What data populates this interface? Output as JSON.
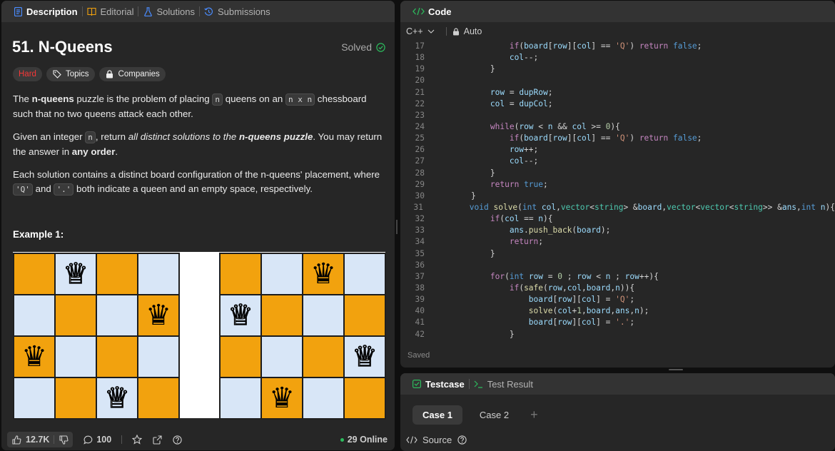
{
  "left_tabs": [
    {
      "label": "Description"
    },
    {
      "label": "Editorial"
    },
    {
      "label": "Solutions"
    },
    {
      "label": "Submissions"
    }
  ],
  "problem": {
    "title": "51. N-Queens",
    "status": "Solved",
    "difficulty": "Hard",
    "tags": [
      "Topics",
      "Companies"
    ],
    "p1": {
      "a": "The ",
      "b": "n-queens",
      "c": " puzzle is the problem of placing ",
      "d": "n",
      "e": " queens on an ",
      "f": "n x n",
      "g": " chessboard such that no two queens attack each other."
    },
    "p2": {
      "a": "Given an integer ",
      "b": "n",
      "c": ", return ",
      "d": "all distinct solutions to the ",
      "e": "n-queens puzzle",
      "f": ". You may return the answer in ",
      "g": "any order",
      "h": "."
    },
    "p3": {
      "a": "Each solution contains a distinct board configuration of the n-queens' placement, where ",
      "b": "'Q'",
      "c": " and ",
      "d": "'.'",
      "e": " both indicate a queen and an empty space, respectively."
    },
    "example_title": "Example 1:"
  },
  "footer": {
    "likes": "12.7K",
    "comments": "100",
    "online": "29 Online"
  },
  "code_panel": {
    "title": "Code",
    "language": "C++",
    "mode": "Auto",
    "saved": "Saved",
    "lines": [
      {
        "n": "17",
        "t": "            if(board[row][col] == 'Q') return false;"
      },
      {
        "n": "18",
        "t": "            col--;"
      },
      {
        "n": "19",
        "t": "        }"
      },
      {
        "n": "20",
        "t": ""
      },
      {
        "n": "21",
        "t": "        row = dupRow;"
      },
      {
        "n": "22",
        "t": "        col = dupCol;"
      },
      {
        "n": "23",
        "t": ""
      },
      {
        "n": "24",
        "t": "        while(row < n && col >= 0){"
      },
      {
        "n": "25",
        "t": "            if(board[row][col] == 'Q') return false;"
      },
      {
        "n": "26",
        "t": "            row++;"
      },
      {
        "n": "27",
        "t": "            col--;"
      },
      {
        "n": "28",
        "t": "        }"
      },
      {
        "n": "29",
        "t": "        return true;"
      },
      {
        "n": "30",
        "t": "    }"
      },
      {
        "n": "31",
        "t": "    void solve(int col,vector<string> &board,vector<vector<string>> &ans,int n){"
      },
      {
        "n": "32",
        "t": "        if(col == n){"
      },
      {
        "n": "33",
        "t": "            ans.push_back(board);"
      },
      {
        "n": "34",
        "t": "            return;"
      },
      {
        "n": "35",
        "t": "        }"
      },
      {
        "n": "36",
        "t": ""
      },
      {
        "n": "37",
        "t": "        for(int row = 0 ; row < n ; row++){"
      },
      {
        "n": "38",
        "t": "            if(safe(row,col,board,n)){"
      },
      {
        "n": "39",
        "t": "                board[row][col] = 'Q';"
      },
      {
        "n": "40",
        "t": "                solve(col+1,board,ans,n);"
      },
      {
        "n": "41",
        "t": "                board[row][col] = '.';"
      },
      {
        "n": "42",
        "t": "            }"
      }
    ]
  },
  "test_panel": {
    "tabs": [
      "Testcase",
      "Test Result"
    ],
    "cases": [
      "Case 1",
      "Case 2"
    ],
    "source": "Source"
  },
  "boards": [
    [
      [
        0,
        1,
        0,
        0
      ],
      [
        0,
        0,
        0,
        1
      ],
      [
        1,
        0,
        0,
        0
      ],
      [
        0,
        0,
        1,
        0
      ]
    ],
    [
      [
        0,
        0,
        1,
        0
      ],
      [
        1,
        0,
        0,
        0
      ],
      [
        0,
        0,
        0,
        1
      ],
      [
        0,
        1,
        0,
        0
      ]
    ]
  ],
  "colors": {
    "accent_orange": "#f2a20e",
    "light_square": "#d8e6f7",
    "hard": "#f63737",
    "solved": "#2cbb5d"
  }
}
